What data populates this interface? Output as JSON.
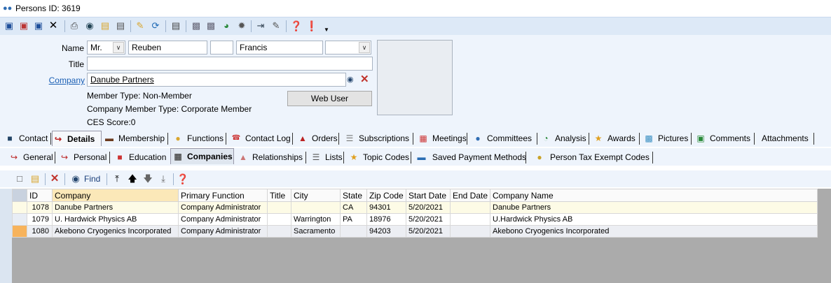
{
  "window": {
    "title": "Persons ID: 3619"
  },
  "form": {
    "name_label": "Name",
    "title_label": "Title",
    "company_label": "Company",
    "prefix": "Mr.",
    "first_name": "Reuben",
    "middle_name": "",
    "last_name": "Francis",
    "suffix": "",
    "title_value": "",
    "company_value": "Danube Partners",
    "member_type": "Member Type: Non-Member",
    "company_member_type": "Company Member Type: Corporate Member",
    "ces_score": "CES Score:0",
    "web_user_button": "Web User"
  },
  "main_tabs": [
    "Contact",
    "Details",
    "Membership",
    "Functions",
    "Contact Log",
    "Orders",
    "Subscriptions",
    "Meetings",
    "Committees",
    "Analysis",
    "Awards",
    "Pictures",
    "Comments",
    "Attachments"
  ],
  "active_main_tab": "Details",
  "sub_tabs": [
    "General",
    "Personal",
    "Education",
    "Companies",
    "Relationships",
    "Lists",
    "Topic Codes",
    "Saved Payment Methods",
    "Person Tax Exempt Codes"
  ],
  "active_sub_tab": "Companies",
  "sub_toolbar": {
    "find_label": "Find"
  },
  "grid": {
    "columns": [
      "ID",
      "Company",
      "Primary Function",
      "Title",
      "City",
      "State",
      "Zip Code",
      "Start Date",
      "End Date",
      "Company Name"
    ],
    "rows": [
      {
        "id": "1078",
        "company": "Danube Partners",
        "function": "Company Administrator",
        "title": "",
        "city": "",
        "state": "CA",
        "zip": "94301",
        "start": "5/20/2021",
        "end": "",
        "company_name": "Danube Partners"
      },
      {
        "id": "1079",
        "company": "U. Hardwick Physics AB",
        "function": "Company Administrator",
        "title": "",
        "city": "Warrington",
        "state": "PA",
        "zip": "18976",
        "start": "5/20/2021",
        "end": "",
        "company_name": "U.Hardwick Physics AB"
      },
      {
        "id": "1080",
        "company": "Akebono Cryogenics Incorporated",
        "function": "Company Administrator",
        "title": "",
        "city": "Sacramento",
        "state": "",
        "zip": "94203",
        "start": "5/20/2021",
        "end": "",
        "company_name": "Akebono Cryogenics Incorporated"
      }
    ]
  }
}
